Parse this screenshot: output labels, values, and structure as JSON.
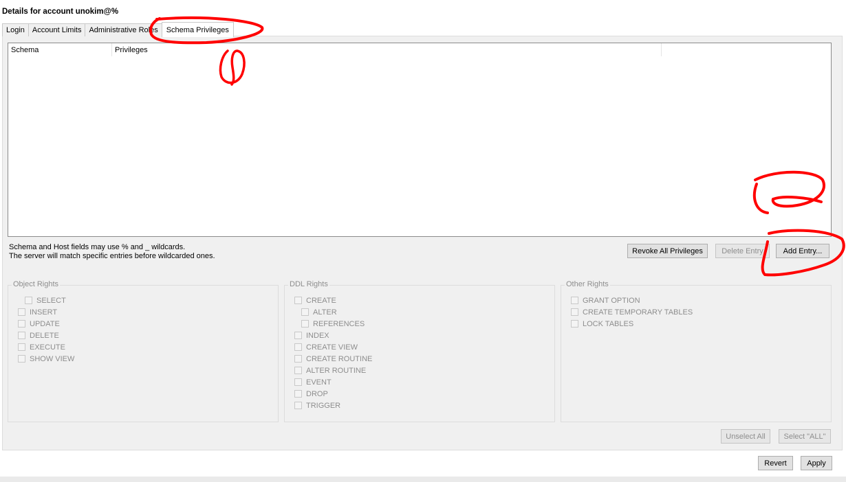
{
  "title": "Details for account unokim@%",
  "tabs": [
    "Login",
    "Account Limits",
    "Administrative Roles",
    "Schema Privileges"
  ],
  "active_tab": "Schema Privileges",
  "table": {
    "columns": [
      "Schema",
      "Privileges"
    ]
  },
  "hint": {
    "line1": "Schema and Host fields may use % and _ wildcards.",
    "line2": "The server will match specific entries before wildcarded ones."
  },
  "buttons": {
    "revoke_all": "Revoke All Privileges",
    "delete_entry": "Delete Entry",
    "add_entry": "Add Entry...",
    "unselect_all": "Unselect All",
    "select_all": "Select \"ALL\"",
    "revert": "Revert",
    "apply": "Apply"
  },
  "groups": {
    "object_rights": {
      "title": "Object Rights",
      "items": [
        "SELECT",
        "INSERT",
        "UPDATE",
        "DELETE",
        "EXECUTE",
        "SHOW VIEW"
      ]
    },
    "ddl_rights": {
      "title": "DDL Rights",
      "items": [
        "CREATE",
        "ALTER",
        "REFERENCES",
        "INDEX",
        "CREATE VIEW",
        "CREATE ROUTINE",
        "ALTER ROUTINE",
        "EVENT",
        "DROP",
        "TRIGGER"
      ]
    },
    "other_rights": {
      "title": "Other Rights",
      "items": [
        "GRANT OPTION",
        "CREATE TEMPORARY TABLES",
        "LOCK TABLES"
      ]
    }
  },
  "colors": {
    "annotation": "#ff0000",
    "panel_bg": "#f0f0f0",
    "disabled_text": "#8d8d8d"
  }
}
